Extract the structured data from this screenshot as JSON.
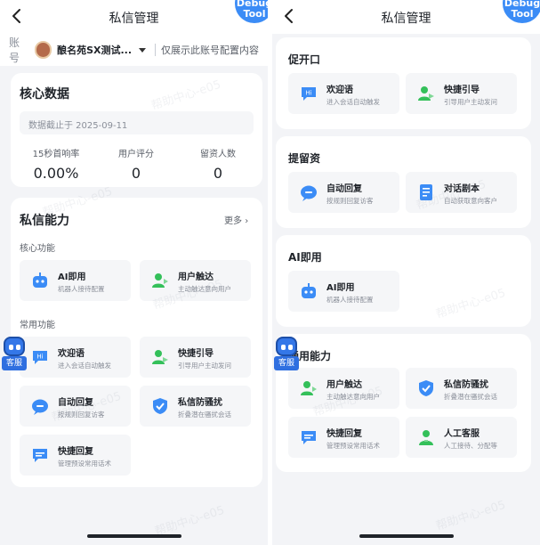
{
  "left": {
    "title": "私信管理",
    "debug": [
      "Debug",
      "Tool"
    ],
    "account": {
      "label": "账号",
      "name": "酿名苑SX测试...",
      "hint": "仅展示此账号配置内容"
    },
    "core_data": {
      "heading": "核心数据",
      "date_text": "数据截止于 2025-09-11",
      "metrics": [
        {
          "label": "15秒首响率",
          "value": "0.00%"
        },
        {
          "label": "用户评分",
          "value": "0"
        },
        {
          "label": "留资人数",
          "value": "0"
        }
      ]
    },
    "capability": {
      "heading": "私信能力",
      "more": "更多",
      "core_label": "核心功能",
      "core_items": [
        {
          "name": "AI即用",
          "desc": "机器人接待配置",
          "icon": "robot-icon"
        },
        {
          "name": "用户触达",
          "desc": "主动触达意向用户",
          "icon": "user-reach-icon"
        }
      ],
      "common_label": "常用功能",
      "common_items": [
        {
          "name": "欢迎语",
          "desc": "进入会话自动触发",
          "icon": "hi-bubble-icon"
        },
        {
          "name": "快捷引导",
          "desc": "引导用户主动发问",
          "icon": "guide-icon"
        },
        {
          "name": "自动回复",
          "desc": "按规则回复访客",
          "icon": "auto-reply-icon"
        },
        {
          "name": "私信防骚扰",
          "desc": "折叠潜在骚扰会话",
          "icon": "shield-icon"
        },
        {
          "name": "快捷回复",
          "desc": "管理预设常用话术",
          "icon": "quick-reply-icon"
        }
      ]
    },
    "kefu": "客服",
    "watermark": "帮助中心-e05"
  },
  "right": {
    "title": "私信管理",
    "debug": [
      "Debug",
      "Tool"
    ],
    "sections": [
      {
        "heading": "促开口",
        "items": [
          {
            "name": "欢迎语",
            "desc": "进入会话自动触发",
            "icon": "hi-bubble-icon"
          },
          {
            "name": "快捷引导",
            "desc": "引导用户主动发问",
            "icon": "guide-icon"
          }
        ]
      },
      {
        "heading": "提留资",
        "items": [
          {
            "name": "自动回复",
            "desc": "按规则回复访客",
            "icon": "auto-reply-icon"
          },
          {
            "name": "对话剧本",
            "desc": "自动获取意向客户",
            "icon": "script-icon"
          }
        ]
      },
      {
        "heading": "AI即用",
        "items": [
          {
            "name": "AI即用",
            "desc": "机器人接待配置",
            "icon": "robot-icon"
          }
        ]
      },
      {
        "heading": "通用能力",
        "items": [
          {
            "name": "用户触达",
            "desc": "主动触达意向用户",
            "icon": "user-reach-icon"
          },
          {
            "name": "私信防骚扰",
            "desc": "折叠潜在骚扰会话",
            "icon": "shield-icon"
          },
          {
            "name": "快捷回复",
            "desc": "管理预设常用话术",
            "icon": "quick-reply-icon"
          },
          {
            "name": "人工客服",
            "desc": "人工接待、分配等",
            "icon": "agent-icon"
          }
        ]
      }
    ],
    "kefu": "客服",
    "watermark": "帮助中心-e05"
  },
  "colors": {
    "accent_blue": "#3b8cf6",
    "accent_green": "#34c05a",
    "page_bg": "#f3f4f7"
  }
}
